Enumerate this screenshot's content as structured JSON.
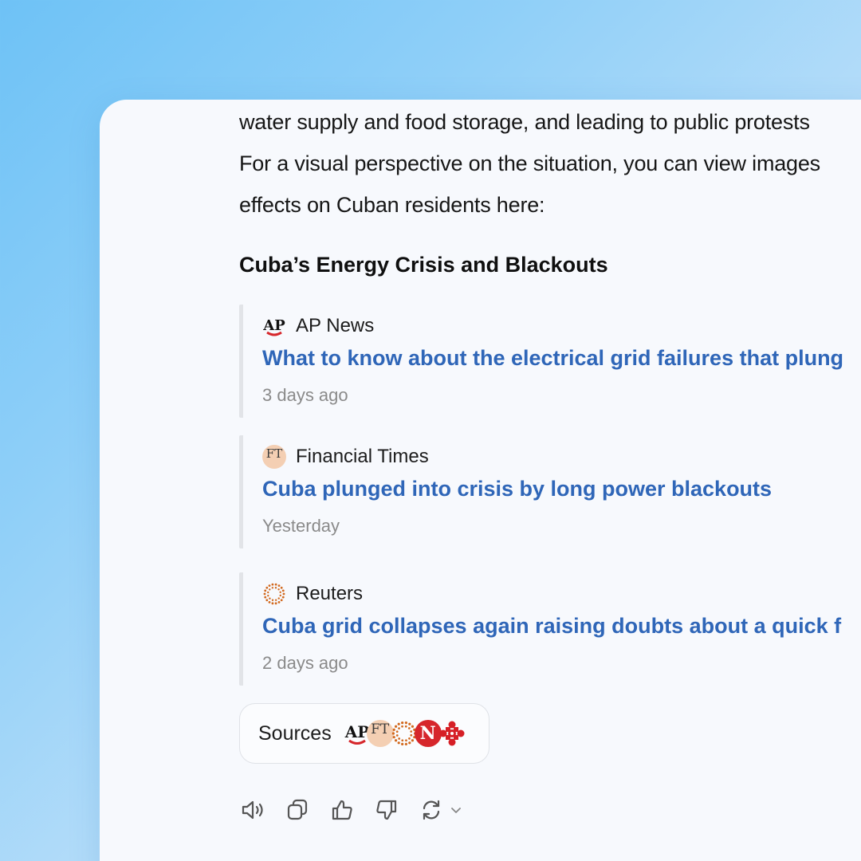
{
  "paragraph": {
    "lines": [
      "water supply and food storage, and leading to public protests",
      "For a visual perspective on the situation, you can view images",
      "effects on Cuban residents here:"
    ]
  },
  "section": {
    "heading": "Cuba’s Energy Crisis and Blackouts"
  },
  "articles": [
    {
      "source": "AP News",
      "logo_text": "AP",
      "headline": "What to know about the electrical grid failures that plung",
      "time": "3 days ago"
    },
    {
      "source": "Financial Times",
      "logo_text": "FT",
      "headline": "Cuba plunged into crisis by long power blackouts",
      "time": "Yesterday"
    },
    {
      "source": "Reuters",
      "headline": "Cuba grid collapses again raising doubts about a quick f",
      "time": "2 days ago"
    }
  ],
  "sources": {
    "label": "Sources",
    "icon_texts": {
      "ap": "AP",
      "ft": "FT",
      "n": "N"
    },
    "icons": [
      "ap-logo-icon",
      "ft-logo-icon",
      "reuters-logo-icon",
      "n-logo-icon",
      "cbc-logo-icon"
    ]
  },
  "actions": [
    "read-aloud-icon",
    "copy-icon",
    "thumbs-up-icon",
    "thumbs-down-icon",
    "regenerate-icon",
    "chevron-down-icon"
  ],
  "colors": {
    "link": "#2f66b8",
    "muted": "#8a8a8a",
    "ft_peach": "#f4cfb3",
    "ap_red": "#d6262b",
    "reuters_orange": "#d2691e",
    "cbc_red": "#d61f26"
  }
}
